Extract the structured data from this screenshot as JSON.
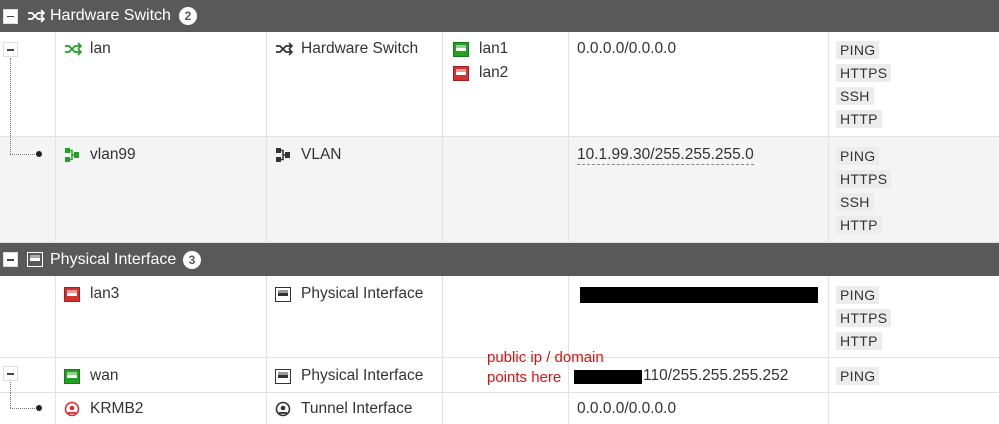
{
  "groups": [
    {
      "title": "Hardware Switch",
      "count": "2",
      "icon": "hardware-switch-icon"
    },
    {
      "title": "Physical Interface",
      "count": "3",
      "icon": "physical-port-icon"
    }
  ],
  "rows": [
    {
      "name": "lan",
      "type": "Hardware Switch",
      "members": [
        "lan1",
        "lan2"
      ],
      "ip": "0.0.0.0/0.0.0.0",
      "access": [
        "PING",
        "HTTPS",
        "SSH",
        "HTTP"
      ]
    },
    {
      "name": "vlan99",
      "type": "VLAN",
      "members": [],
      "ip": "10.1.99.30/255.255.255.0",
      "access": [
        "PING",
        "HTTPS",
        "SSH",
        "HTTP"
      ]
    },
    {
      "name": "lan3",
      "type": "Physical Interface",
      "members": [],
      "ip": "",
      "access": [
        "PING",
        "HTTPS",
        "HTTP"
      ]
    },
    {
      "name": "wan",
      "type": "Physical Interface",
      "members": [],
      "ip": "110/255.255.255.252",
      "access": [
        "PING"
      ]
    },
    {
      "name": "KRMB2",
      "type": "Tunnel Interface",
      "members": [],
      "ip": "0.0.0.0/0.0.0.0",
      "access": []
    }
  ],
  "annotation": {
    "line1": "public ip / domain",
    "line2": "points here"
  },
  "colors": {
    "header_bg": "#595959",
    "port_green": "#22a022",
    "port_red": "#d43030",
    "annotation_red": "#e01010"
  }
}
